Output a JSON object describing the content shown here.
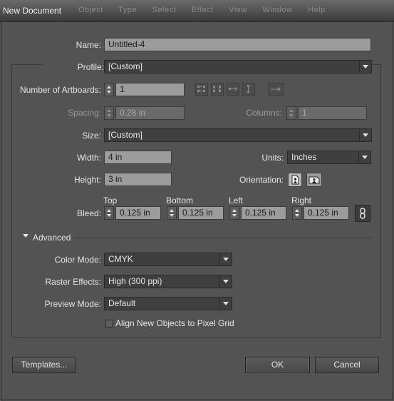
{
  "window": {
    "title": "New Document",
    "menu_items": [
      "Object",
      "Type",
      "Select",
      "Effect",
      "View",
      "Window",
      "Help"
    ]
  },
  "name": {
    "label": "Name:",
    "value": "Untitled-4"
  },
  "profile": {
    "label": "Profile:",
    "value": "[Custom]"
  },
  "artboards": {
    "label": "Number of Artboards:",
    "value": "1"
  },
  "spacing": {
    "label": "Spacing:",
    "value": "0.28 in"
  },
  "columns": {
    "label": "Columns:",
    "value": "1"
  },
  "size": {
    "label": "Size:",
    "value": "[Custom]"
  },
  "width": {
    "label": "Width:",
    "value": "4 in"
  },
  "units": {
    "label": "Units:",
    "value": "Inches"
  },
  "height": {
    "label": "Height:",
    "value": "3 in"
  },
  "orientation": {
    "label": "Orientation:",
    "selected": "portrait"
  },
  "bleed": {
    "label": "Bleed:",
    "top_label": "Top",
    "top": "0.125 in",
    "bottom_label": "Bottom",
    "bottom": "0.125 in",
    "left_label": "Left",
    "left": "0.125 in",
    "right_label": "Right",
    "right": "0.125 in"
  },
  "advanced": {
    "label": "Advanced",
    "expanded": true
  },
  "color_mode": {
    "label": "Color Mode:",
    "value": "CMYK"
  },
  "raster_effects": {
    "label": "Raster Effects:",
    "value": "High (300 ppi)"
  },
  "preview_mode": {
    "label": "Preview Mode:",
    "value": "Default"
  },
  "align_pixel_grid": {
    "label": "Align New Objects to Pixel Grid",
    "checked": false
  },
  "buttons": {
    "templates": "Templates...",
    "ok": "OK",
    "cancel": "Cancel"
  },
  "icons": {
    "artboard_layout": [
      "grid-by-row-icon",
      "grid-by-column-icon",
      "arrange-by-row-icon",
      "arrange-by-column-icon",
      "right-to-left-icon"
    ],
    "link_bleed": "chain-link-icon",
    "orientation": [
      "portrait-icon",
      "landscape-icon"
    ]
  }
}
